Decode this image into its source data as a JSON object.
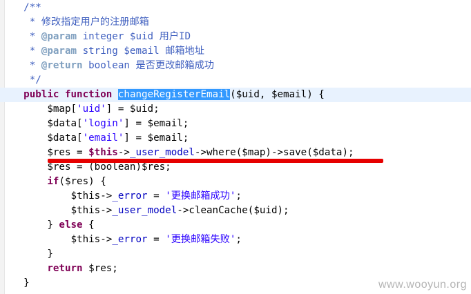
{
  "editor": {
    "lines": [
      {
        "tokens": [
          {
            "t": "    /**",
            "c": "c"
          }
        ]
      },
      {
        "tokens": [
          {
            "t": "     * 修改指定用户的注册邮箱",
            "c": "c"
          }
        ]
      },
      {
        "tokens": [
          {
            "t": "     * ",
            "c": "c"
          },
          {
            "t": "@param",
            "c": "tag"
          },
          {
            "t": " integer $uid 用户ID",
            "c": "c"
          }
        ]
      },
      {
        "tokens": [
          {
            "t": "     * ",
            "c": "c"
          },
          {
            "t": "@param",
            "c": "tag"
          },
          {
            "t": " string $email 邮箱地址",
            "c": "c"
          }
        ]
      },
      {
        "tokens": [
          {
            "t": "     * ",
            "c": "c"
          },
          {
            "t": "@return",
            "c": "tag"
          },
          {
            "t": " boolean 是否更改邮箱成功",
            "c": "c"
          }
        ]
      },
      {
        "tokens": [
          {
            "t": "     */",
            "c": "c"
          }
        ]
      },
      {
        "current": true,
        "tokens": [
          {
            "t": "    ",
            "c": ""
          },
          {
            "t": "public",
            "c": "kw"
          },
          {
            "t": " ",
            "c": ""
          },
          {
            "t": "function",
            "c": "kw"
          },
          {
            "t": " ",
            "c": ""
          },
          {
            "t": "changeRegisterEmail",
            "c": "sel"
          },
          {
            "t": "($uid, $email) {",
            "c": ""
          }
        ]
      },
      {
        "tokens": [
          {
            "t": "        $map[",
            "c": ""
          },
          {
            "t": "'uid'",
            "c": "str"
          },
          {
            "t": "] = $uid;",
            "c": ""
          }
        ]
      },
      {
        "tokens": [
          {
            "t": "        $data[",
            "c": ""
          },
          {
            "t": "'login'",
            "c": "str"
          },
          {
            "t": "] = $email;",
            "c": ""
          }
        ]
      },
      {
        "tokens": [
          {
            "t": "        $data[",
            "c": ""
          },
          {
            "t": "'email'",
            "c": "str"
          },
          {
            "t": "] = $email;",
            "c": ""
          }
        ]
      },
      {
        "tokens": [
          {
            "t": "        $res = ",
            "c": ""
          },
          {
            "t": "$this",
            "c": "kw"
          },
          {
            "t": "->",
            "c": ""
          },
          {
            "t": "_user_model",
            "c": "fld"
          },
          {
            "t": "->where($map)->save($data);",
            "c": ""
          }
        ]
      },
      {
        "tokens": [
          {
            "t": "        $res = (boolean)$res;",
            "c": ""
          }
        ]
      },
      {
        "tokens": [
          {
            "t": "        ",
            "c": ""
          },
          {
            "t": "if",
            "c": "kw"
          },
          {
            "t": "($res) {",
            "c": ""
          }
        ]
      },
      {
        "tokens": [
          {
            "t": "            ",
            "c": ""
          },
          {
            "t": "$this",
            "c": ""
          },
          {
            "t": "->",
            "c": ""
          },
          {
            "t": "_error",
            "c": "fld"
          },
          {
            "t": " = ",
            "c": ""
          },
          {
            "t": "'更换邮箱成功'",
            "c": "str"
          },
          {
            "t": ";",
            "c": ""
          }
        ]
      },
      {
        "tokens": [
          {
            "t": "            ",
            "c": ""
          },
          {
            "t": "$this",
            "c": ""
          },
          {
            "t": "->",
            "c": ""
          },
          {
            "t": "_user_model",
            "c": "fld"
          },
          {
            "t": "->cleanCache($uid);",
            "c": ""
          }
        ]
      },
      {
        "tokens": [
          {
            "t": "        } ",
            "c": ""
          },
          {
            "t": "else",
            "c": "kw"
          },
          {
            "t": " {",
            "c": ""
          }
        ]
      },
      {
        "tokens": [
          {
            "t": "            ",
            "c": ""
          },
          {
            "t": "$this",
            "c": ""
          },
          {
            "t": "->",
            "c": ""
          },
          {
            "t": "_error",
            "c": "fld"
          },
          {
            "t": " = ",
            "c": ""
          },
          {
            "t": "'更换邮箱失败'",
            "c": "str"
          },
          {
            "t": ";",
            "c": ""
          }
        ]
      },
      {
        "tokens": [
          {
            "t": "        }",
            "c": ""
          }
        ]
      },
      {
        "tokens": [
          {
            "t": "        ",
            "c": ""
          },
          {
            "t": "return",
            "c": "kw"
          },
          {
            "t": " $res;",
            "c": ""
          }
        ]
      },
      {
        "tokens": [
          {
            "t": "    }",
            "c": ""
          }
        ]
      }
    ]
  },
  "watermark": "www.wooyun.org",
  "colors": {
    "comment": "#3f5fbf",
    "doc_tag": "#7f9fbf",
    "keyword": "#7f0055",
    "string": "#2a00ff",
    "field": "#0000c0",
    "selection": "#3399ff",
    "annotation_underline": "#e60000"
  }
}
